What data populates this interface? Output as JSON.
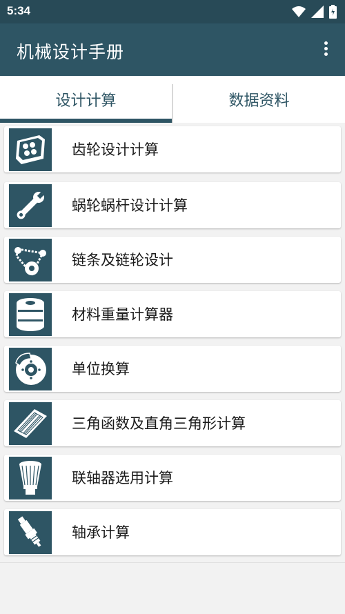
{
  "status": {
    "time": "5:34"
  },
  "app": {
    "title": "机械设计手册"
  },
  "tabs": [
    {
      "label": "设计计算",
      "selected": true
    },
    {
      "label": "数据资料",
      "selected": false
    }
  ],
  "items": [
    {
      "label": "齿轮设计计算",
      "icon": "engine-block-icon"
    },
    {
      "label": "蜗轮蜗杆设计计算",
      "icon": "wrench-icon"
    },
    {
      "label": "链条及链轮设计",
      "icon": "chain-drive-icon"
    },
    {
      "label": "材料重量计算器",
      "icon": "oil-filter-icon"
    },
    {
      "label": "单位换算",
      "icon": "brake-disc-icon"
    },
    {
      "label": "三角函数及直角三角形计算",
      "icon": "air-filter-icon"
    },
    {
      "label": "联轴器选用计算",
      "icon": "cone-filter-icon"
    },
    {
      "label": "轴承计算",
      "icon": "spark-plug-icon"
    }
  ],
  "colors": {
    "primary": "#2e5564",
    "statusbar": "#284a57",
    "background": "#f2f2f2"
  }
}
